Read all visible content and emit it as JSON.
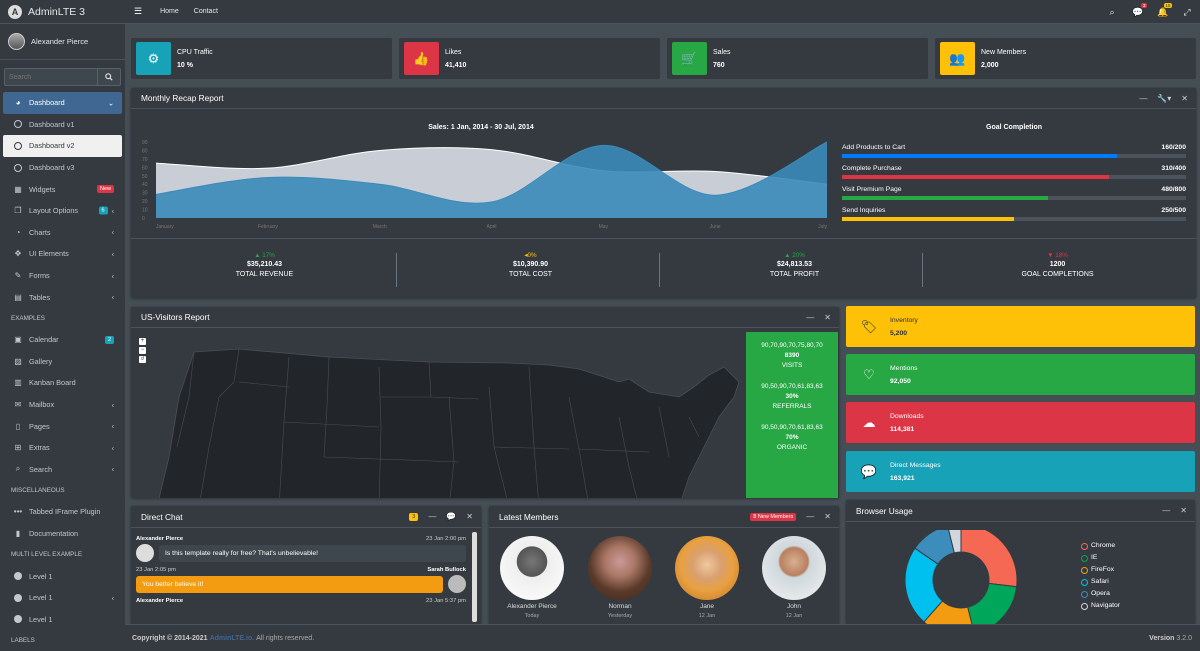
{
  "brand": {
    "name": "AdminLTE 3"
  },
  "user": {
    "name": "Alexander Pierce"
  },
  "sidebar": {
    "search_placeholder": "Search",
    "items": [
      {
        "label": "Dashboard"
      },
      {
        "label": "Dashboard v1"
      },
      {
        "label": "Dashboard v2"
      },
      {
        "label": "Dashboard v3"
      },
      {
        "label": "Widgets",
        "badge": "New"
      },
      {
        "label": "Layout Options",
        "badge": "6"
      },
      {
        "label": "Charts"
      },
      {
        "label": "UI Elements"
      },
      {
        "label": "Forms"
      },
      {
        "label": "Tables"
      },
      {
        "label": "Calendar",
        "badge": "2"
      },
      {
        "label": "Gallery"
      },
      {
        "label": "Kanban Board"
      },
      {
        "label": "Mailbox"
      },
      {
        "label": "Pages"
      },
      {
        "label": "Extras"
      },
      {
        "label": "Search"
      },
      {
        "label": "Tabbed IFrame Plugin"
      },
      {
        "label": "Documentation"
      },
      {
        "label": "Level 1"
      },
      {
        "label": "Level 1"
      },
      {
        "label": "Level 1"
      }
    ],
    "headers": {
      "examples": "EXAMPLES",
      "misc": "MISCELLANEOUS",
      "multi": "MULTI LEVEL EXAMPLE",
      "labels": "LABELS"
    }
  },
  "topbar": {
    "home": "Home",
    "contact": "Contact",
    "msg_count": "3",
    "notif_count": "15"
  },
  "info_boxes": [
    {
      "label": "CPU Traffic",
      "value": "10 %",
      "color": "#17a2b8",
      "icon": "gear-icon"
    },
    {
      "label": "Likes",
      "value": "41,410",
      "color": "#dc3545",
      "icon": "thumbs-up-icon"
    },
    {
      "label": "Sales",
      "value": "760",
      "color": "#28a745",
      "icon": "cart-icon"
    },
    {
      "label": "New Members",
      "value": "2,000",
      "color": "#ffc107",
      "icon": "users-icon"
    }
  ],
  "recap": {
    "title": "Monthly Recap Report",
    "goal_title": "Goal Completion",
    "goals": [
      {
        "label": "Add Products to Cart",
        "value": "160/200",
        "fraction": 0.8,
        "color": "#007bff"
      },
      {
        "label": "Complete Purchase",
        "value": "310/400",
        "fraction": 0.775,
        "color": "#dc3545"
      },
      {
        "label": "Visit Premium Page",
        "value": "480/800",
        "fraction": 0.6,
        "color": "#28a745"
      },
      {
        "label": "Send Inquiries",
        "value": "250/500",
        "fraction": 0.5,
        "color": "#ffc107"
      }
    ],
    "stats": [
      {
        "pct": "17%",
        "dir": "up",
        "color": "#28a745",
        "amount": "$35,210.43",
        "label": "TOTAL REVENUE"
      },
      {
        "pct": "0%",
        "dir": "flat",
        "color": "#ffc107",
        "amount": "$10,390.90",
        "label": "TOTAL COST"
      },
      {
        "pct": "20%",
        "dir": "up",
        "color": "#28a745",
        "amount": "$24,813.53",
        "label": "TOTAL PROFIT"
      },
      {
        "pct": "18%",
        "dir": "down",
        "color": "#dc3545",
        "amount": "1200",
        "label": "GOAL COMPLETIONS"
      }
    ]
  },
  "chart_data": {
    "type": "area",
    "title": "Sales: 1 Jan, 2014 - 30 Jul, 2014",
    "categories": [
      "January",
      "February",
      "March",
      "April",
      "May",
      "June",
      "July"
    ],
    "ylim": [
      0,
      90
    ],
    "yticks": [
      0,
      10,
      20,
      30,
      40,
      50,
      60,
      70,
      80,
      90
    ],
    "series": [
      {
        "values": [
          65,
          59,
          80,
          81,
          56,
          55,
          40
        ],
        "color": "#d2d6de"
      },
      {
        "values": [
          28,
          48,
          40,
          19,
          86,
          27,
          90
        ],
        "color": "#3b8bba"
      }
    ]
  },
  "visitors": {
    "title": "US-Visitors Report",
    "stats": [
      {
        "spark": "90,70,90,70,75,80,70",
        "value": "8390",
        "label": "VISITS"
      },
      {
        "spark": "90,50,90,70,61,83,63",
        "value": "30%",
        "label": "REFERRALS"
      },
      {
        "spark": "90,50,90,70,61,83,63",
        "value": "70%",
        "label": "ORGANIC"
      }
    ]
  },
  "small_boxes": [
    {
      "label": "Inventory",
      "value": "5,200",
      "color": "#ffc107",
      "text_color": "#1f2d3d",
      "icon": "tag-icon"
    },
    {
      "label": "Mentions",
      "value": "92,050",
      "color": "#28a745",
      "text_color": "#ffffff",
      "icon": "heart-icon"
    },
    {
      "label": "Downloads",
      "value": "114,381",
      "color": "#dc3545",
      "text_color": "#ffffff",
      "icon": "cloud-download-icon"
    },
    {
      "label": "Direct Messages",
      "value": "163,921",
      "color": "#17a2b8",
      "text_color": "#ffffff",
      "icon": "comment-icon"
    }
  ],
  "chat": {
    "title": "Direct Chat",
    "badge": "3",
    "messages": [
      {
        "name": "Alexander Pierce",
        "time": "23 Jan 2:00 pm",
        "text": "Is this template really for free? That's unbelievable!"
      },
      {
        "name": "Sarah Bullock",
        "time": "23 Jan 2:05 pm",
        "text": "You better believe it!"
      },
      {
        "name": "Alexander Pierce",
        "time": "23 Jan 5:37 pm",
        "text": ""
      }
    ]
  },
  "members": {
    "title": "Latest Members",
    "badge": "8 New Members",
    "list": [
      {
        "name": "Alexander Pierce",
        "date": "Today"
      },
      {
        "name": "Norman",
        "date": "Yesterday"
      },
      {
        "name": "Jane",
        "date": "12 Jan"
      },
      {
        "name": "John",
        "date": "12 Jan"
      }
    ]
  },
  "browser": {
    "title": "Browser Usage",
    "legend": [
      {
        "name": "Chrome",
        "color": "#f56954",
        "value": 700
      },
      {
        "name": "IE",
        "color": "#00a65a",
        "value": 500
      },
      {
        "name": "FireFox",
        "color": "#f39c12",
        "value": 400
      },
      {
        "name": "Safari",
        "color": "#00c0ef",
        "value": 600
      },
      {
        "name": "Opera",
        "color": "#3c8dbc",
        "value": 300
      },
      {
        "name": "Navigator",
        "color": "#d2d6de",
        "value": 100
      }
    ]
  },
  "footer": {
    "copyright": "Copyright © 2014-2021",
    "link": "AdminLTE.io.",
    "rights": "All rights reserved.",
    "version_label": "Version",
    "version": "3.2.0"
  }
}
